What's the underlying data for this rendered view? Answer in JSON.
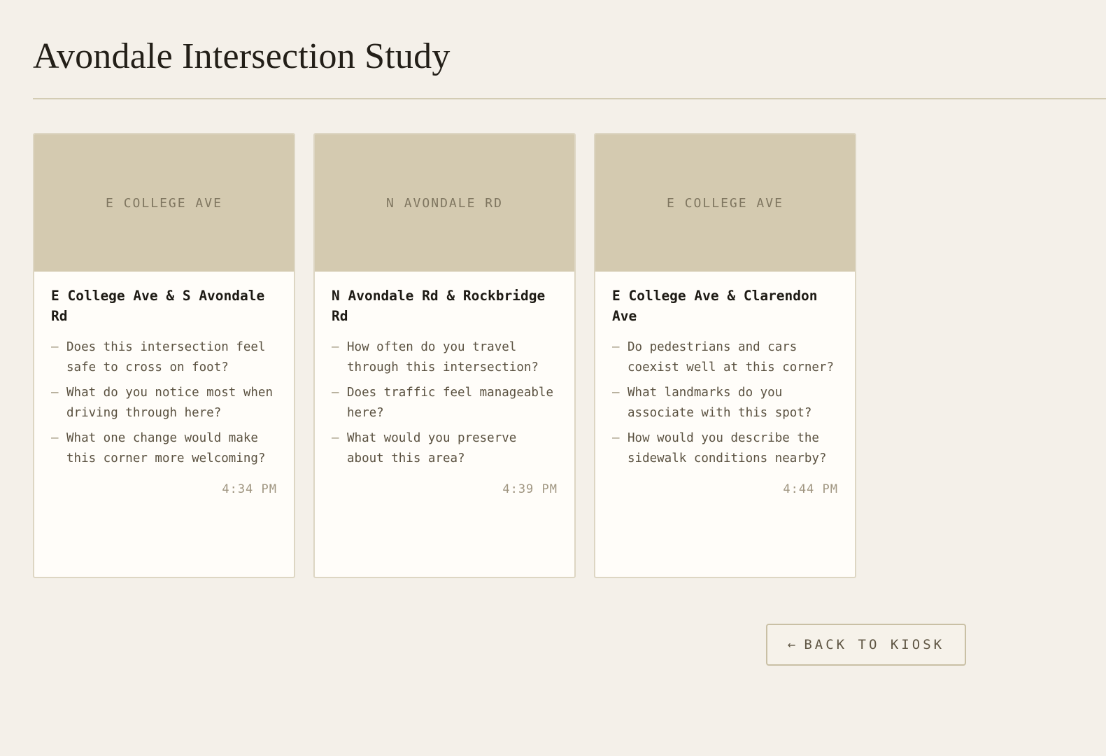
{
  "page": {
    "title": "Avondale Intersection Study"
  },
  "cards": [
    {
      "photo_label": "E COLLEGE AVE",
      "heading": "E College Ave & S Avondale Rd",
      "questions": [
        "Does this intersection feel safe to cross on foot?",
        "What do you notice most when driving through here?",
        "What one change would make this corner more welcoming?"
      ],
      "time": "4:34 PM"
    },
    {
      "photo_label": "N AVONDALE RD",
      "heading": "N Avondale Rd & Rockbridge Rd",
      "questions": [
        "How often do you travel through this intersection?",
        "Does traffic feel manageable here?",
        "What would you preserve about this area?"
      ],
      "time": "4:39 PM"
    },
    {
      "photo_label": "E COLLEGE AVE",
      "heading": "E College Ave & Clarendon Ave",
      "questions": [
        "Do pedestrians and cars coexist well at this corner?",
        "What landmarks do you associate with this spot?",
        "How would you describe the sidewalk conditions nearby?"
      ],
      "time": "4:44 PM"
    }
  ],
  "list_marker": "—",
  "back_button": {
    "arrow": "←",
    "label": "BACK TO KIOSK"
  },
  "colors": {
    "background": "#f4f0e9",
    "photo_placeholder": "#d4cab0",
    "card": "#fffdf9",
    "accent_border": "#c9c0a5"
  },
  "icons": {
    "back": "left-arrow-icon"
  }
}
